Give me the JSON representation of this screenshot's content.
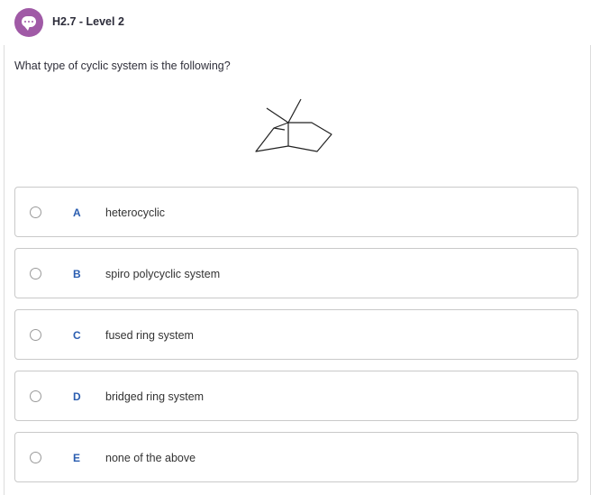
{
  "header": {
    "title": "H2.7 - Level 2",
    "badge_icon": "chat-bubble-icon",
    "badge_color": "#a05aa6"
  },
  "question": {
    "text": "What type of cyclic system is the following?"
  },
  "options": [
    {
      "letter": "A",
      "text": "heterocyclic"
    },
    {
      "letter": "B",
      "text": "spiro polycyclic system"
    },
    {
      "letter": "C",
      "text": "fused ring system"
    },
    {
      "letter": "D",
      "text": "bridged ring system"
    },
    {
      "letter": "E",
      "text": "none of the above"
    }
  ],
  "colors": {
    "letter": "#2a5db0",
    "border": "#c9c9c9"
  }
}
